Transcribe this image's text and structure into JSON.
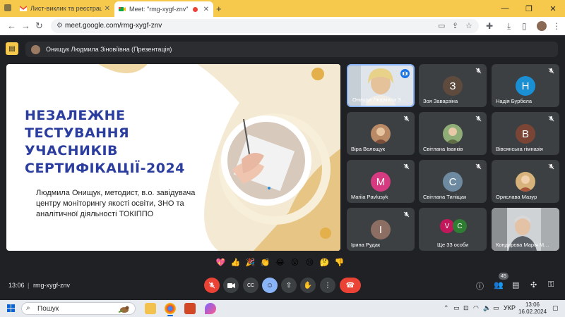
{
  "browser": {
    "tabs": [
      {
        "label": "Лист-виклик та реєстрація ф…",
        "active": false
      },
      {
        "label": "Meet: \"rmg-xygf-znv\"",
        "active": true
      }
    ],
    "url": "meet.google.com/rmg-xygf-znv"
  },
  "meet": {
    "presenter_label": "Онищук Людмила Зіновіївна (Презентація)",
    "slide": {
      "title_lines": [
        "НЕЗАЛЕЖНЕ",
        "ТЕСТУВАННЯ",
        "УЧАСНИКІВ",
        "СЕРТИФІКАЦІЇ-2024"
      ],
      "author_lines": [
        "Людмила Онищук, методист, в.о. завідувача",
        "центру моніторингу якості освіти, ЗНО та",
        "аналітичної діяльності ТОКІППО"
      ]
    },
    "participants": [
      {
        "name": "Онищук Людмила З…",
        "initial": "",
        "color": "",
        "speaking": true
      },
      {
        "name": "Зоя Заварзіна",
        "initial": "З",
        "color": "#5f4b3e"
      },
      {
        "name": "Надія Бурбела",
        "initial": "Н",
        "color": "#1a8fd4"
      },
      {
        "name": "Віра Волощук",
        "initial": "",
        "color": "#a57a5a"
      },
      {
        "name": "Світлана Іванків",
        "initial": "",
        "color": "#6d8a5a"
      },
      {
        "name": "Вівсянська гімназія",
        "initial": "В",
        "color": "#7a4535"
      },
      {
        "name": "Mariia Pavlusyk",
        "initial": "M",
        "color": "#d63a80"
      },
      {
        "name": "Світлана Тиліщак",
        "initial": "С",
        "color": "#6d8aa0"
      },
      {
        "name": "Орислава Мазур",
        "initial": "",
        "color": "#c9a26a"
      },
      {
        "name": "Ірина Рудак",
        "initial": "І",
        "color": "#8d6e63"
      },
      {
        "name": "Ще 33 особи",
        "more_initials": [
          "V",
          "C"
        ],
        "more_colors": [
          "#c2185b",
          "#2e7d32"
        ]
      },
      {
        "name": "Кондирєва Марія М…",
        "initial": "",
        "color": "#999"
      }
    ],
    "reactions": [
      "💖",
      "👍",
      "🎉",
      "👏",
      "😂",
      "😮",
      "😢",
      "🤔",
      "👎"
    ],
    "time": "13:06",
    "separator": "|",
    "meeting_code": "rmg-xygf-znv",
    "people_count": "45",
    "controls": {
      "mic": "mic-off-icon",
      "camera": "camera-off-icon",
      "captions": "CC",
      "reactions": "emoji-icon",
      "present": "present-icon",
      "raise_hand": "hand-icon",
      "more": "more-icon",
      "leave": "leave-call-icon"
    }
  },
  "taskbar": {
    "search_placeholder": "Пошук",
    "lang": "УКР",
    "time": "13:06",
    "date": "16.02.2024"
  }
}
